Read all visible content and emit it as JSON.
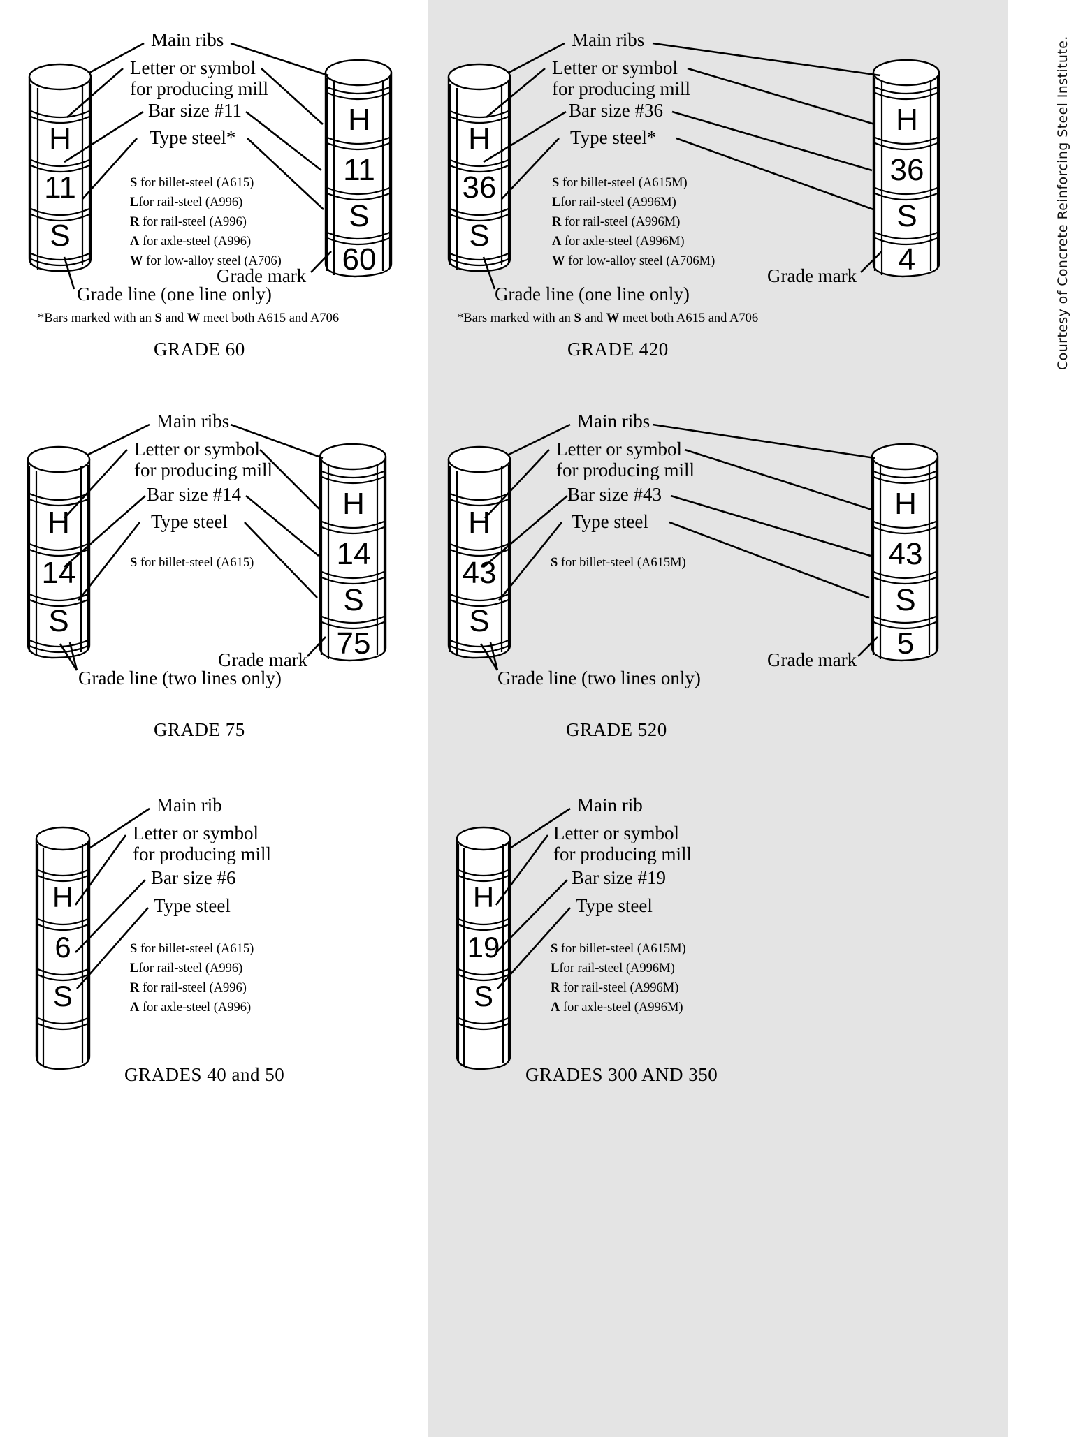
{
  "courtesy_note": "Courtesy of Concrete Reinforcing Steel Institute.",
  "common": {
    "main_ribs": "Main ribs",
    "main_rib": "Main rib",
    "letter_symbol_line1": "Letter or symbol",
    "letter_symbol_line2": "for producing mill",
    "grade_mark": "Grade mark",
    "type_steel": "Type steel",
    "type_steel_star": "Type steel*"
  },
  "panels": [
    {
      "id": "grade-60",
      "caption": "GRADE 60",
      "bar_size_label": "Bar size #11",
      "type_steel_label": "Type steel*",
      "grade_line_label": "Grade line (one line only)",
      "footnote": "*Bars marked with an S and W meet both A615 and A706",
      "footnote_parts": [
        "*Bars marked with an ",
        "S",
        " and ",
        "W",
        " meet both A615 and A706"
      ],
      "type_list": [
        {
          "code": "S",
          "text": " for billet-steel (A615)"
        },
        {
          "code": "L",
          "text": "for rail-steel (A996)"
        },
        {
          "code": "R",
          "text": " for rail-steel (A996)"
        },
        {
          "code": "A",
          "text": " for axle-steel (A996)"
        },
        {
          "code": "W",
          "text": " for low-alloy steel (A706)"
        }
      ],
      "left_bar_marks": [
        "H",
        "11",
        "S"
      ],
      "right_bar_marks": [
        "H",
        "11",
        "S",
        "60"
      ],
      "grade_mark_value": "60",
      "metric": false
    },
    {
      "id": "grade-420",
      "caption": "GRADE 420",
      "bar_size_label": "Bar size #36",
      "type_steel_label": "Type steel*",
      "grade_line_label": "Grade line (one line only)",
      "footnote": "*Bars marked with an S and W meet both A615 and A706",
      "footnote_parts": [
        "*Bars marked with an ",
        "S",
        " and ",
        "W",
        " meet both A615 and A706"
      ],
      "type_list": [
        {
          "code": "S",
          "text": " for billet-steel (A615M)"
        },
        {
          "code": "L",
          "text": "for rail-steel (A996M)"
        },
        {
          "code": "R",
          "text": " for rail-steel (A996M)"
        },
        {
          "code": "A",
          "text": " for axle-steel (A996M)"
        },
        {
          "code": "W",
          "text": " for low-alloy steel (A706M)"
        }
      ],
      "left_bar_marks": [
        "H",
        "36",
        "S"
      ],
      "right_bar_marks": [
        "H",
        "36",
        "S",
        "4"
      ],
      "grade_mark_value": "4",
      "metric": true
    },
    {
      "id": "grade-75",
      "caption": "GRADE 75",
      "bar_size_label": "Bar size #14",
      "type_steel_label": "Type steel",
      "grade_line_label": "Grade line (two lines only)",
      "footnote": "",
      "type_list": [
        {
          "code": "S",
          "text": " for billet-steel (A615)"
        }
      ],
      "left_bar_marks": [
        "H",
        "14",
        "S"
      ],
      "right_bar_marks": [
        "H",
        "14",
        "S",
        "75"
      ],
      "grade_mark_value": "75",
      "metric": false
    },
    {
      "id": "grade-520",
      "caption": "GRADE 520",
      "bar_size_label": "Bar size #43",
      "type_steel_label": "Type steel",
      "grade_line_label": "Grade line (two lines only)",
      "footnote": "",
      "type_list": [
        {
          "code": "S",
          "text": " for billet-steel (A615M)"
        }
      ],
      "left_bar_marks": [
        "H",
        "43",
        "S"
      ],
      "right_bar_marks": [
        "H",
        "43",
        "S",
        "5"
      ],
      "grade_mark_value": "5",
      "metric": true
    },
    {
      "id": "grades-40-50",
      "caption": "GRADES 40 and 50",
      "bar_size_label": "Bar size #6",
      "type_steel_label": "Type steel",
      "grade_line_label": "",
      "footnote": "",
      "type_list": [
        {
          "code": "S",
          "text": " for billet-steel (A615)"
        },
        {
          "code": "L",
          "text": "for rail-steel (A996)"
        },
        {
          "code": "R",
          "text": " for rail-steel (A996)"
        },
        {
          "code": "A",
          "text": " for axle-steel (A996)"
        }
      ],
      "left_bar_marks": [
        "H",
        "6",
        "S"
      ],
      "right_bar_marks": [],
      "grade_mark_value": "",
      "metric": false
    },
    {
      "id": "grades-300-350",
      "caption": "GRADES 300 AND 350",
      "bar_size_label": "Bar size #19",
      "type_steel_label": "Type steel",
      "grade_line_label": "",
      "footnote": "",
      "type_list": [
        {
          "code": "S",
          "text": " for billet-steel (A615M)"
        },
        {
          "code": "L",
          "text": "for rail-steel (A996M)"
        },
        {
          "code": "R",
          "text": " for rail-steel (A996M)"
        },
        {
          "code": "A",
          "text": " for axle-steel (A996M)"
        }
      ],
      "left_bar_marks": [
        "H",
        "19",
        "S"
      ],
      "right_bar_marks": [],
      "grade_mark_value": "",
      "metric": true
    }
  ],
  "colors": {
    "metric_background": "#e4e4e4",
    "ink": "#000000",
    "page": "#ffffff"
  }
}
